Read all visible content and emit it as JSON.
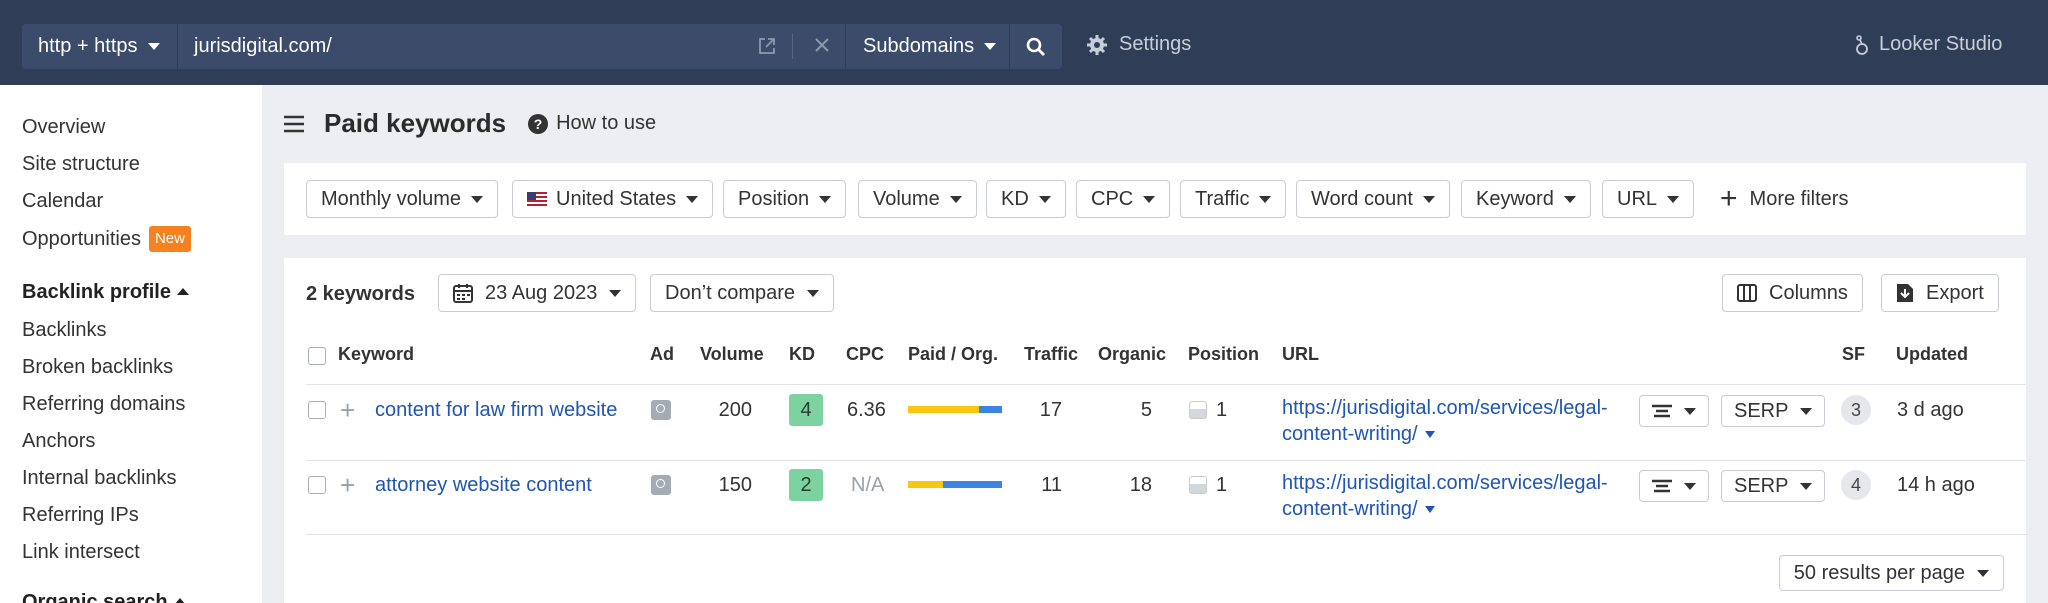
{
  "topbar": {
    "protocol": "http + https",
    "url_value": "jurisdigital.com/",
    "scope": "Subdomains",
    "settings": "Settings",
    "looker": "Looker Studio"
  },
  "sidebar": {
    "items_top": [
      "Overview",
      "Site structure",
      "Calendar",
      "Opportunities"
    ],
    "new_badge": "New",
    "section_backlinks": "Backlink profile",
    "items_backlinks": [
      "Backlinks",
      "Broken backlinks",
      "Referring domains",
      "Anchors",
      "Internal backlinks",
      "Referring IPs",
      "Link intersect"
    ],
    "section_organic": "Organic search"
  },
  "header": {
    "title": "Paid keywords",
    "how_to_use": "How to use"
  },
  "filters": {
    "items": [
      "Monthly volume",
      "United States",
      "Position",
      "Volume",
      "KD",
      "CPC",
      "Traffic",
      "Word count",
      "Keyword",
      "URL"
    ],
    "more": "More filters"
  },
  "toolbar": {
    "count": "2 keywords",
    "date": "23 Aug 2023",
    "compare": "Don’t compare",
    "columns": "Columns",
    "export": "Export"
  },
  "table": {
    "headers": [
      "Keyword",
      "Ad",
      "Volume",
      "KD",
      "CPC",
      "Paid / Org.",
      "Traffic",
      "Organic",
      "Position",
      "URL",
      "SF",
      "Updated"
    ],
    "rows": [
      {
        "keyword": "content for law firm website",
        "volume": "200",
        "kd": "4",
        "cpc": "6.36",
        "paid_share": 0.75,
        "traffic": "17",
        "organic": "5",
        "position": "1",
        "url_line1": "https://jurisdigital.com/services/legal-",
        "url_line2": "content-writing/",
        "serp": "SERP",
        "sf": "3",
        "updated": "3 d ago"
      },
      {
        "keyword": "attorney website content",
        "volume": "150",
        "kd": "2",
        "cpc": "N/A",
        "paid_share": 0.37,
        "traffic": "11",
        "organic": "18",
        "position": "1",
        "url_line1": "https://jurisdigital.com/services/legal-",
        "url_line2": "content-writing/",
        "serp": "SERP",
        "sf": "4",
        "updated": "14 h ago"
      }
    ]
  },
  "footer": {
    "per_page": "50 results per page"
  },
  "colors": {
    "topbar_bg": "#2f3d57",
    "link": "#1f55b4",
    "kd_easy": "#7dd3a0",
    "paid_bar": "#f7c80f",
    "organic_bar": "#3b84e0",
    "new_badge": "#f6821f"
  },
  "icons": [
    "chevron-down-icon",
    "external-link-icon",
    "close-icon",
    "search-icon",
    "gear-icon",
    "looker-icon",
    "hamburger-icon",
    "help-icon",
    "flag-us-icon",
    "plus-icon",
    "calendar-icon",
    "columns-icon",
    "export-icon",
    "ad-search-icon",
    "position-icon",
    "serp-features-icon"
  ]
}
